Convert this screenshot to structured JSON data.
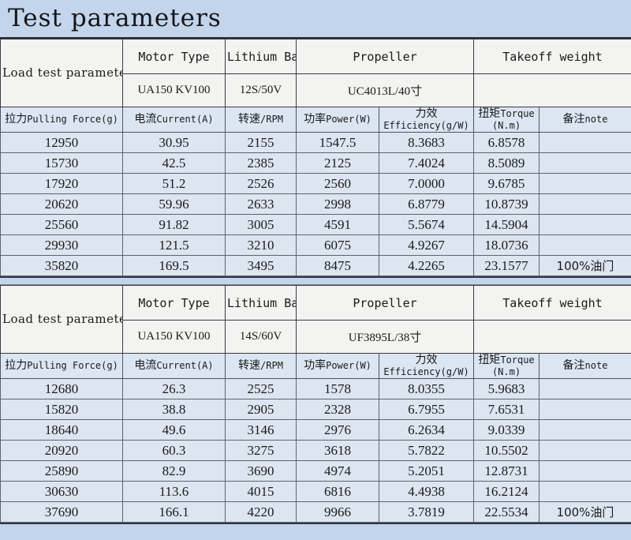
{
  "title": "Test parameters",
  "colors": {
    "banner": "#c3d5ea",
    "meta_cell": "#f3f3f1",
    "col_header": "#dce6f3",
    "data_row": "#dde5f0",
    "border": "#555f6b"
  },
  "meta_headers": {
    "load_test": "Load test parameters",
    "motor_type": "Motor Type",
    "battery": "Lithium Battery",
    "propeller": "Propeller",
    "takeoff_weight": "Takeoff weight"
  },
  "column_headers": {
    "force_cn": "拉力",
    "force_en": "Pulling Force(g)",
    "current_cn": "电流",
    "current_en": "Current(A)",
    "rpm_cn": "转速",
    "rpm_en": "/RPM",
    "power_cn": "功率",
    "power_en": "Power(W)",
    "eff_cn": "力效",
    "eff_en": "Efficiency(g/W)",
    "torque_cn": "扭矩",
    "torque_en": "Torque",
    "torque_unit": "(N.m)",
    "note_cn": "备注",
    "note_en": "note"
  },
  "tables": [
    {
      "meta": {
        "motor_type": "UA150 KV100",
        "battery": "12S/50V",
        "propeller": "UC4013L/40寸",
        "takeoff_weight": ""
      },
      "rows": [
        {
          "force": "12950",
          "current": "30.95",
          "rpm": "2155",
          "power": "1547.5",
          "efficiency": "8.3683",
          "torque": "6.8578",
          "note": ""
        },
        {
          "force": "15730",
          "current": "42.5",
          "rpm": "2385",
          "power": "2125",
          "efficiency": "7.4024",
          "torque": "8.5089",
          "note": ""
        },
        {
          "force": "17920",
          "current": "51.2",
          "rpm": "2526",
          "power": "2560",
          "efficiency": "7.0000",
          "torque": "9.6785",
          "note": ""
        },
        {
          "force": "20620",
          "current": "59.96",
          "rpm": "2633",
          "power": "2998",
          "efficiency": "6.8779",
          "torque": "10.8739",
          "note": ""
        },
        {
          "force": "25560",
          "current": "91.82",
          "rpm": "3005",
          "power": "4591",
          "efficiency": "5.5674",
          "torque": "14.5904",
          "note": ""
        },
        {
          "force": "29930",
          "current": "121.5",
          "rpm": "3210",
          "power": "6075",
          "efficiency": "4.9267",
          "torque": "18.0736",
          "note": ""
        },
        {
          "force": "35820",
          "current": "169.5",
          "rpm": "3495",
          "power": "8475",
          "efficiency": "4.2265",
          "torque": "23.1577",
          "note": "100%油门"
        }
      ]
    },
    {
      "meta": {
        "motor_type": "UA150 KV100",
        "battery": "14S/60V",
        "propeller": "UF3895L/38寸",
        "takeoff_weight": ""
      },
      "rows": [
        {
          "force": "12680",
          "current": "26.3",
          "rpm": "2525",
          "power": "1578",
          "efficiency": "8.0355",
          "torque": "5.9683",
          "note": ""
        },
        {
          "force": "15820",
          "current": "38.8",
          "rpm": "2905",
          "power": "2328",
          "efficiency": "6.7955",
          "torque": "7.6531",
          "note": ""
        },
        {
          "force": "18640",
          "current": "49.6",
          "rpm": "3146",
          "power": "2976",
          "efficiency": "6.2634",
          "torque": "9.0339",
          "note": ""
        },
        {
          "force": "20920",
          "current": "60.3",
          "rpm": "3275",
          "power": "3618",
          "efficiency": "5.7822",
          "torque": "10.5502",
          "note": ""
        },
        {
          "force": "25890",
          "current": "82.9",
          "rpm": "3690",
          "power": "4974",
          "efficiency": "5.2051",
          "torque": "12.8731",
          "note": ""
        },
        {
          "force": "30630",
          "current": "113.6",
          "rpm": "4015",
          "power": "6816",
          "efficiency": "4.4938",
          "torque": "16.2124",
          "note": ""
        },
        {
          "force": "37690",
          "current": "166.1",
          "rpm": "4220",
          "power": "9966",
          "efficiency": "3.7819",
          "torque": "22.5534",
          "note": "100%油门"
        }
      ]
    }
  ]
}
